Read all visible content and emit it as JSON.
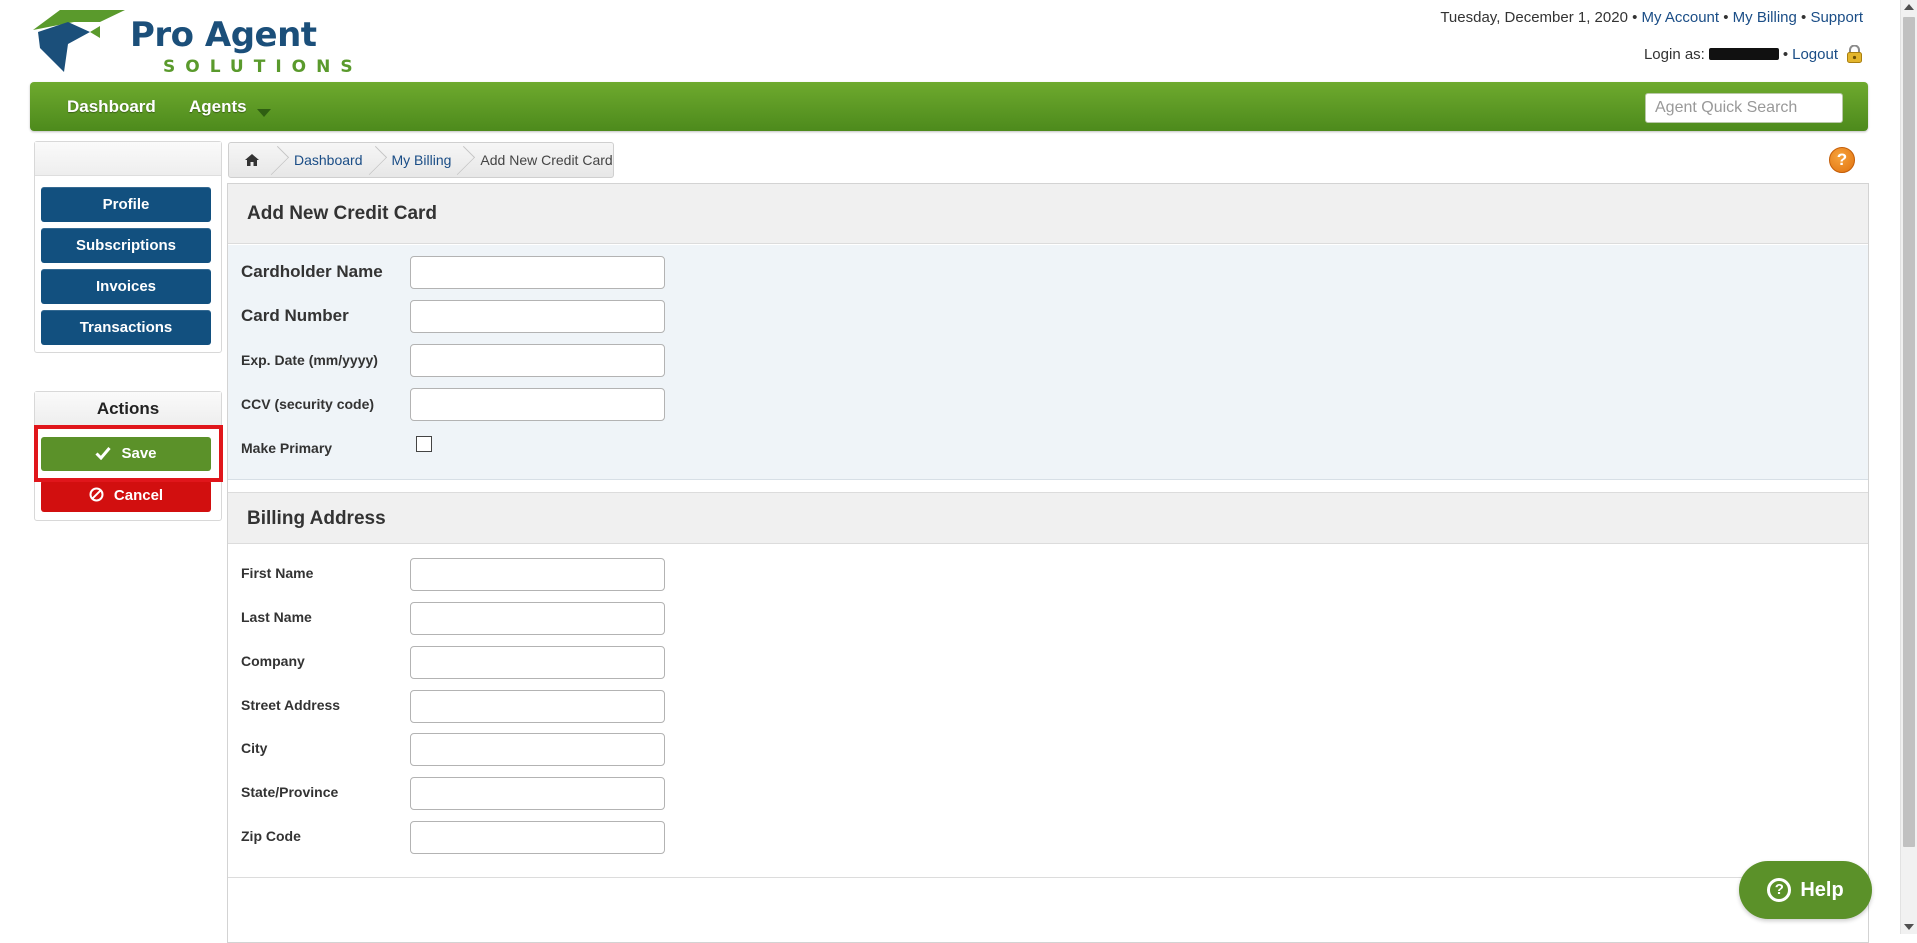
{
  "brand": {
    "name_line1": "Pro Agent",
    "name_line2": "SOLUTIONS",
    "colors": {
      "blue": "#1b4f7a",
      "green": "#5a9a2c"
    }
  },
  "header": {
    "date": "Tuesday, December 1, 2020",
    "separator": " • ",
    "links": {
      "my_account": "My Account",
      "my_billing": "My Billing",
      "support": "Support"
    },
    "login_label": "Login as:",
    "logout": "Logout"
  },
  "nav": {
    "items": [
      {
        "label": "Dashboard"
      },
      {
        "label": "Agents",
        "has_dropdown": true
      }
    ],
    "search_placeholder": "Agent Quick Search",
    "color": "#5f9b27"
  },
  "sidebar": {
    "buttons": [
      {
        "label": "Profile"
      },
      {
        "label": "Subscriptions"
      },
      {
        "label": "Invoices"
      },
      {
        "label": "Transactions"
      }
    ],
    "actions_title": "Actions",
    "save_label": "Save",
    "cancel_label": "Cancel",
    "save_icon": "check-icon",
    "cancel_icon": "no-entry-icon"
  },
  "breadcrumb": {
    "home_icon": "home-icon",
    "items": [
      "Dashboard",
      "My Billing",
      "Add New Credit Card"
    ]
  },
  "help_icon": "question-icon",
  "card_section": {
    "title": "Add New Credit Card",
    "fields": [
      {
        "label": "Cardholder Name",
        "value": ""
      },
      {
        "label": "Card Number",
        "value": ""
      },
      {
        "label": "Exp. Date (mm/yyyy)",
        "value": ""
      },
      {
        "label": "CCV (security code)",
        "value": ""
      }
    ],
    "make_primary_label": "Make Primary",
    "make_primary_checked": false
  },
  "billing_section": {
    "title": "Billing Address",
    "fields": [
      {
        "label": "First Name",
        "value": ""
      },
      {
        "label": "Last Name",
        "value": ""
      },
      {
        "label": "Company",
        "value": ""
      },
      {
        "label": "Street Address",
        "value": ""
      },
      {
        "label": "City",
        "value": ""
      },
      {
        "label": "State/Province",
        "value": ""
      },
      {
        "label": "Zip Code",
        "value": ""
      }
    ]
  },
  "help_button": {
    "label": "Help",
    "icon": "question-circle-icon"
  },
  "highlight_color": "#e0161b"
}
